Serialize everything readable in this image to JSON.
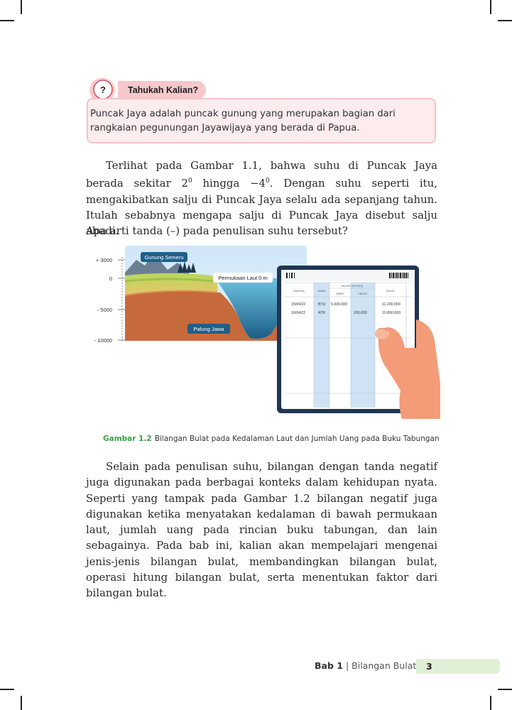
{
  "infobox": {
    "badge_symbol": "?",
    "title": "Tahukah Kalian?",
    "text_line1": "Puncak Jaya adalah puncak gunung yang merupakan bagian dari",
    "text_line2": "rangkaian pegunungan Jayawijaya yang berada di Papua."
  },
  "paragraph1": {
    "seg1": "Terlihat pada Gambar 1.1, bahwa suhu di Puncak Jaya berada sekitar 2",
    "sup1": "0",
    "seg2": " hingga −4",
    "sup2": "0",
    "seg3": ". Dengan suhu seperti itu, mengakibatkan salju di Puncak Jaya selalu ada sepanjang tahun. Itulah sebabnya mengapa salju di Puncak Jaya disebut salju abadi."
  },
  "question": "Apa arti tanda (–) pada penulisan suhu tersebut?",
  "figure": {
    "depth_scale": {
      "ticks": [
        "+ 3000",
        "0",
        "- 5000",
        "- 10000"
      ]
    },
    "labels": {
      "mountain": "Gunung Semeru",
      "sea_level": "Permukaan Laut 0 m",
      "trench": "Palung Jawa"
    },
    "bankbook": {
      "headers": {
        "tanggal": "TANGGAL",
        "sandi": "SANDI",
        "mutasi": "MUTASI (RUPIAH)",
        "debet": "DEBET",
        "kredit": "KREDIT",
        "saldo": "SALDO"
      },
      "rows": [
        {
          "tanggal": "15/04/22",
          "sandi": "BTU",
          "debet": "5.000.000",
          "kredit": "",
          "saldo": "11.200.000"
        },
        {
          "tanggal": "16/04/22",
          "sandi": "ATR",
          "debet": "",
          "kredit": "200.000",
          "saldo": "10.800.000"
        }
      ]
    }
  },
  "caption": {
    "label": "Gambar 1.2",
    "text": "Bilangan Bulat pada Kedalaman Laut dan Jumlah Uang pada Buku Tabungan"
  },
  "paragraph2": "Selain pada penulisan suhu, bilangan dengan tanda negatif juga digunakan pada berbagai konteks dalam kehidupan nyata. Seperti yang tampak pada Gambar 1.2 bilangan negatif juga digunakan ketika menyatakan kedalaman di bawah permukaan laut, jumlah uang pada rincian buku tabungan, dan lain sebagainya. Pada bab ini, kalian akan mempelajari mengenai jenis-jenis bilangan bulat, membandingkan bilangan bulat, operasi hitung bilangan bulat, serta menentukan faktor dari bilangan bulat.",
  "footer": {
    "chapter": "Bab 1",
    "separator": " | ",
    "title": "Bilangan Bulat",
    "page_number": "3"
  }
}
